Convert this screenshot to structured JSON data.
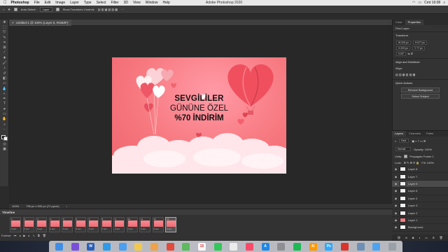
{
  "menubar": {
    "app_name": "Photoshop",
    "items": [
      "File",
      "Edit",
      "Image",
      "Layer",
      "Type",
      "Select",
      "Filter",
      "3D",
      "View",
      "Window",
      "Help"
    ],
    "window_title": "Adobe Photoshop 2020",
    "clock": "Cmt 16:08"
  },
  "options": {
    "auto_select_label": "Auto-Select:",
    "auto_select_value": "Layer",
    "show_transform_label": "Show Transform Controls"
  },
  "document": {
    "tab_title": "Untitled-1 @ 100% (Layer 5, RGB/8*)",
    "zoom": "100%",
    "dimensions": "795 px x 500 px (72 ppcm)"
  },
  "artboard": {
    "line1": "SEVGİLİLER",
    "line2": "GÜNÜNE ÖZEL",
    "line3": "%70 İNDİRİM",
    "bg_color": "#f7787f",
    "text_color": "#111111"
  },
  "timeline": {
    "title": "Timeline",
    "frames": [
      {
        "num": "1",
        "delay": "0 sec."
      },
      {
        "num": "2",
        "delay": "0 sec."
      },
      {
        "num": "3",
        "delay": "0 sec."
      },
      {
        "num": "4",
        "delay": "0 sec."
      },
      {
        "num": "5",
        "delay": "0 sec."
      },
      {
        "num": "6",
        "delay": "0 sec."
      },
      {
        "num": "7",
        "delay": "0 sec."
      },
      {
        "num": "8",
        "delay": "0 sec."
      },
      {
        "num": "9",
        "delay": "0 sec."
      },
      {
        "num": "10",
        "delay": "0 sec."
      },
      {
        "num": "11",
        "delay": "0 sec."
      },
      {
        "num": "12",
        "delay": "0 sec."
      },
      {
        "num": "13",
        "delay": "0 sec."
      }
    ],
    "selected_frame": 13,
    "loop": "Forever"
  },
  "properties": {
    "tabs": [
      "Color",
      "Properties"
    ],
    "layer_type": "Pixel Layer",
    "transform_title": "Transform",
    "w": "W 229 px",
    "h": "H 677 px",
    "x": "X 229 px",
    "y": "Y 77 px",
    "angle": "0.00°",
    "align_title": "Align and Distribute",
    "align_label": "Align:",
    "quick_actions_title": "Quick Actions",
    "remove_bg": "Remove Background",
    "select_subject": "Select Subject"
  },
  "layers_panel": {
    "tabs": [
      "Layers",
      "Channels",
      "Paths"
    ],
    "filter": "Kind",
    "blend_mode": "Normal",
    "opacity_label": "Opacity: 100%",
    "unify_label": "Unify:",
    "propagate_label": "Propagate Frame 1",
    "lock_label": "Lock:",
    "fill_label": "Fill: 100%",
    "layers": [
      {
        "name": "Layer 8",
        "thumb": "checker"
      },
      {
        "name": "Layer 7",
        "thumb": "checker"
      },
      {
        "name": "Layer 5",
        "thumb": "checker"
      },
      {
        "name": "Layer 6",
        "thumb": "checker"
      },
      {
        "name": "Layer 4",
        "thumb": "checker"
      },
      {
        "name": "Layer 3",
        "thumb": "checker"
      },
      {
        "name": "Layer 2",
        "thumb": "checker"
      },
      {
        "name": "Layer 1",
        "thumb": "pink"
      },
      {
        "name": "Background",
        "thumb": "white"
      }
    ],
    "selected_layer": "Layer 5"
  },
  "dock": {
    "apps": [
      {
        "name": "finder-icon",
        "color": "#3f8ee6",
        "glyph": ""
      },
      {
        "name": "siri-icon",
        "color": "#7a4fd8",
        "glyph": ""
      },
      {
        "name": "word-icon",
        "color": "#2b5eb8",
        "glyph": "W"
      },
      {
        "name": "safari-icon",
        "color": "#2f9ae8",
        "glyph": ""
      },
      {
        "name": "mail-icon",
        "color": "#4a9ff0",
        "glyph": ""
      },
      {
        "name": "notes-icon",
        "color": "#f2c94c",
        "glyph": ""
      },
      {
        "name": "photos-icon",
        "color": "#f0a24a",
        "glyph": ""
      },
      {
        "name": "chrome-icon",
        "color": "#e24a3b",
        "glyph": ""
      },
      {
        "name": "maps-icon",
        "color": "#5fb95f",
        "glyph": ""
      },
      {
        "name": "calendar-icon",
        "color": "#f7f7f7",
        "glyph": "15"
      },
      {
        "name": "messages-icon",
        "color": "#34c759",
        "glyph": ""
      },
      {
        "name": "reminders-icon",
        "color": "#ececec",
        "glyph": ""
      },
      {
        "name": "music-icon",
        "color": "#fa4a6a",
        "glyph": ""
      },
      {
        "name": "appstore-icon",
        "color": "#1e88e5",
        "glyph": "A"
      },
      {
        "name": "settings-icon",
        "color": "#8e8e93",
        "glyph": ""
      },
      {
        "name": "spotify-icon",
        "color": "#1db954",
        "glyph": ""
      },
      {
        "name": "illustrator-icon",
        "color": "#ff9a00",
        "glyph": "Ai"
      },
      {
        "name": "photoshop-icon",
        "color": "#31a8ff",
        "glyph": "Ps"
      },
      {
        "name": "acrobat-icon",
        "color": "#d9342b",
        "glyph": ""
      },
      {
        "name": "preview-icon",
        "color": "#6d8fb5",
        "glyph": ""
      },
      {
        "name": "folder-icon",
        "color": "#4da3f0",
        "glyph": ""
      },
      {
        "name": "trash-icon",
        "color": "#9aa0a8",
        "glyph": ""
      }
    ]
  }
}
